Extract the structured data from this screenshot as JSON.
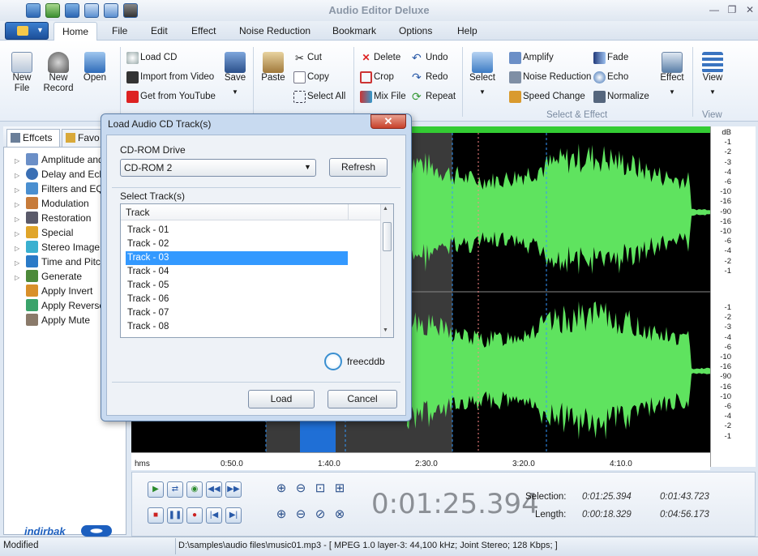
{
  "app": {
    "title": "Audio Editor Deluxe"
  },
  "menu": [
    "Home",
    "File",
    "Edit",
    "Effect",
    "Noise Reduction",
    "Bookmark",
    "Options",
    "Help"
  ],
  "ribbon": {
    "new_file": "New\nFile",
    "new_record": "New\nRecord",
    "open": "Open",
    "load_cd": "Load CD",
    "import_video": "Import from Video",
    "youtube": "Get from YouTube",
    "save": "Save",
    "paste": "Paste",
    "cut": "Cut",
    "copy": "Copy",
    "select_all": "Select All",
    "delete": "Delete",
    "crop": "Crop",
    "mix_file": "Mix File",
    "undo": "Undo",
    "redo": "Redo",
    "repeat": "Repeat",
    "select": "Select",
    "amplify": "Amplify",
    "noise_reduction": "Noise Reduction",
    "speed_change": "Speed Change",
    "fade": "Fade",
    "echo": "Echo",
    "normalize": "Normalize",
    "effect": "Effect",
    "view": "View",
    "group_select_effect": "Select & Effect",
    "group_view": "View"
  },
  "left_panel": {
    "tab_effects": "Effcets",
    "tab_favorites": "Favo",
    "items": [
      "Amplitude and Compression",
      "Delay and Echo",
      "Filters and EQ",
      "Modulation",
      "Restoration",
      "Special",
      "Stereo Image",
      "Time and Pitch",
      "Generate",
      "Apply Invert",
      "Apply Reverse",
      "Apply Mute"
    ]
  },
  "db_labels_top": [
    "dB",
    "-1",
    "-2",
    "-3",
    "-4",
    "-6",
    "-10",
    "-16",
    "-90",
    "-16",
    "-10",
    "-6",
    "-4",
    "-2",
    "-1"
  ],
  "db_labels_bottom": [
    "-1",
    "-2",
    "-3",
    "-4",
    "-6",
    "-10",
    "-16",
    "-90",
    "-16",
    "-10",
    "-6",
    "-4",
    "-2",
    "-1"
  ],
  "timeline": [
    "hms",
    "0:50.0",
    "1:40.0",
    "2:30.0",
    "3:20.0",
    "4:10.0"
  ],
  "transport": {
    "time": "0:01:25.394",
    "selection_label": "Selection:",
    "length_label": "Length:",
    "sel_start": "0:01:25.394",
    "sel_end": "0:01:43.723",
    "len_sel": "0:00:18.329",
    "len_total": "0:04:56.173"
  },
  "status": {
    "mode": "Modified",
    "file": "D:\\samples\\audio files\\music01.mp3 - [ MPEG 1.0 layer-3: 44,100 kHz; Joint Stereo; 128 Kbps; ]",
    "watermark": "indirbak"
  },
  "dialog": {
    "title": "Load Audio CD Track(s)",
    "cdrom_label": "CD-ROM Drive",
    "cdrom_value": "CD-ROM 2",
    "refresh": "Refresh",
    "select_tracks_label": "Select Track(s)",
    "track_header": "Track",
    "tracks": [
      "Track - 01",
      "Track - 02",
      "Track - 03",
      "Track - 04",
      "Track - 05",
      "Track - 06",
      "Track - 07",
      "Track - 08"
    ],
    "selected_index": 2,
    "freecddb": "freecddb",
    "load": "Load",
    "cancel": "Cancel"
  }
}
